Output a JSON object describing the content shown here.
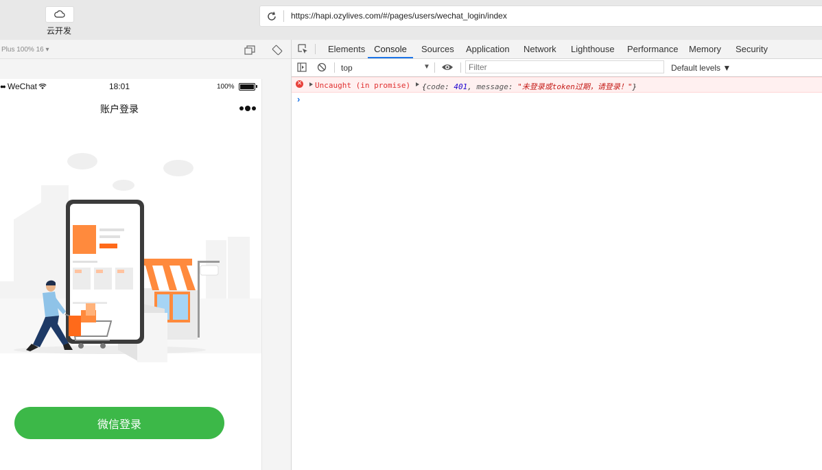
{
  "toolbar": {
    "cloud_label": "云开发",
    "url": "https://hapi.ozylives.com/#/pages/users/wechat_login/index"
  },
  "simulator": {
    "device_label": "Plus 100% 16 ▾",
    "status": {
      "carrier": "WeChat",
      "time": "18:01",
      "battery": "100%"
    },
    "nav_title": "账户登录",
    "login_button": "微信登录"
  },
  "devtools": {
    "tabs": [
      "Elements",
      "Console",
      "Sources",
      "Application",
      "Network",
      "Lighthouse",
      "Performance",
      "Memory",
      "Security"
    ],
    "active_tab": "Console",
    "context": "top",
    "filter_placeholder": "Filter",
    "levels": "Default levels ▼",
    "error": {
      "prefix": "Uncaught (in promise)",
      "open": "{",
      "key1": "code",
      "val1": "401",
      "key2": "message",
      "val2": "\"未登录或token过期，请登录！\"",
      "close": "}"
    }
  },
  "colors": {
    "wechat_green": "#3cb848",
    "devtools_accent": "#1a73e8",
    "error_red": "#e03030"
  }
}
